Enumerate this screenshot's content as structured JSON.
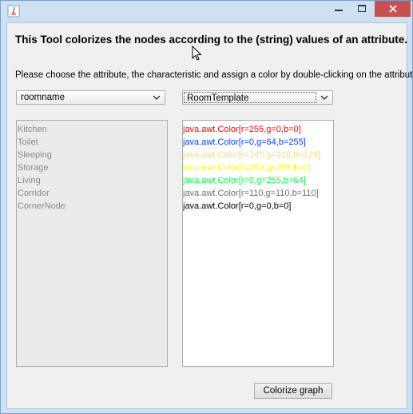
{
  "window": {
    "title": "",
    "app_icon": "java-icon",
    "controls": {
      "minimize_icon": "minimize-icon",
      "maximize_icon": "maximize-icon",
      "close_icon": "close-icon"
    },
    "close_color": "#c75050"
  },
  "heading": "This Tool colorizes the nodes according to the (string) values of an attribute.",
  "instruction": "Please choose the attribute, the characteristic and assign a color by double-clicking on the attribute.",
  "attribute_select": {
    "value": "roomname"
  },
  "characteristic_select": {
    "value": "RoomTemplate"
  },
  "values_list": {
    "items": [
      {
        "label": "Kitchen"
      },
      {
        "label": "Toilet"
      },
      {
        "label": "Sleeping"
      },
      {
        "label": "Storage"
      },
      {
        "label": "Living"
      },
      {
        "label": "Corridor"
      },
      {
        "label": "CornerNode"
      }
    ]
  },
  "colors_list": {
    "items": [
      {
        "label": "java.awt.Color[r=255,g=0,b=0]",
        "color": "#ff0000"
      },
      {
        "label": "java.awt.Color[r=0,g=64,b=255]",
        "color": "#0040ff"
      },
      {
        "label": "java.awt.Color[r=245,g=218,b=129]",
        "color": "#f5da81"
      },
      {
        "label": "java.awt.Color[r=253,g=255,b=0]",
        "color": "#fdff00"
      },
      {
        "label": "java.awt.Color[r=0,g=255,b=64]",
        "color": "#00ff40"
      },
      {
        "label": "java.awt.Color[r=110,g=110,b=110]",
        "color": "#6e6e6e"
      },
      {
        "label": "java.awt.Color[r=0,g=0,b=0]",
        "color": "#000000"
      }
    ]
  },
  "colorize_button": {
    "label": "Colorize graph"
  }
}
